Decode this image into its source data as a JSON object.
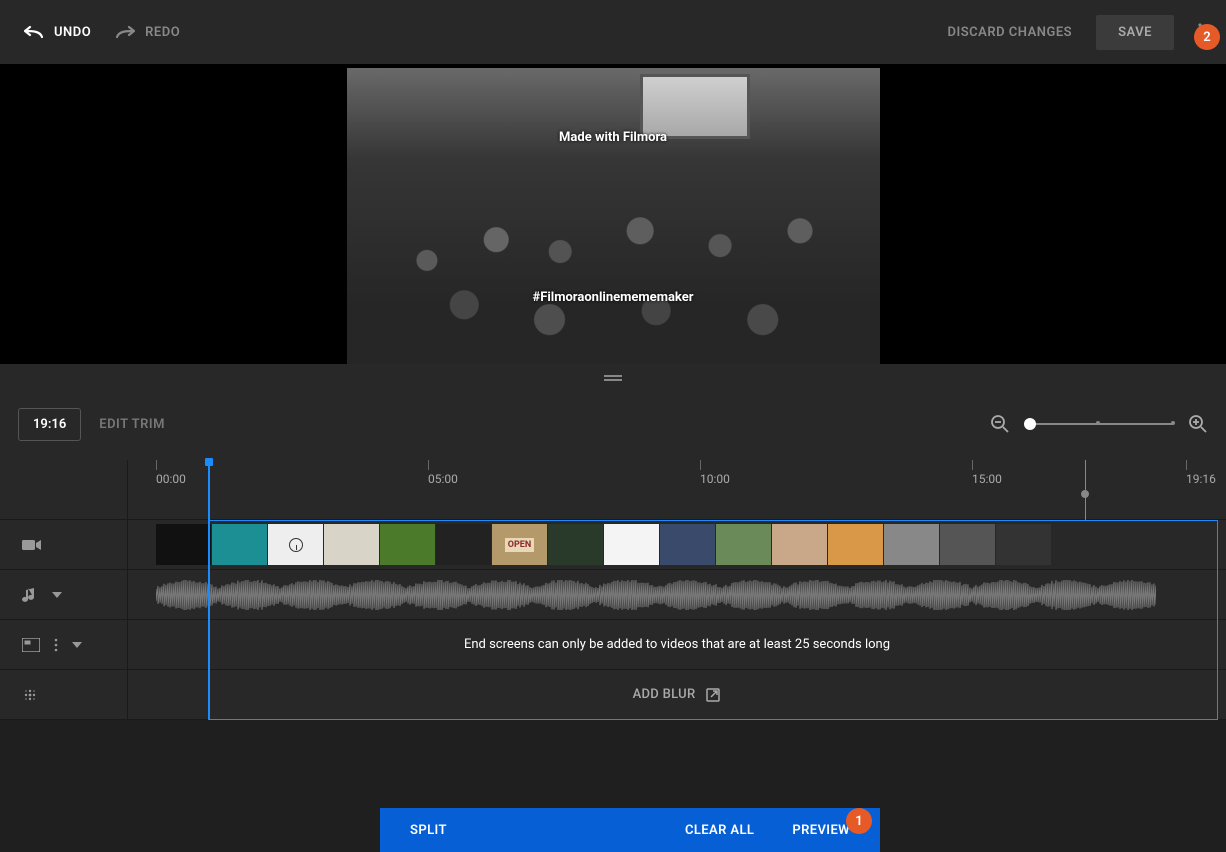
{
  "topbar": {
    "undo": "UNDO",
    "redo": "REDO",
    "discard": "DISCARD CHANGES",
    "save": "SAVE"
  },
  "badges": {
    "one": "1",
    "two": "2"
  },
  "preview": {
    "watermark_top": "Made with Filmora",
    "watermark_bottom": "#Filmoraonlinemememaker"
  },
  "controls": {
    "time": "19:16",
    "edit_trim": "EDIT TRIM"
  },
  "ruler": {
    "ticks": [
      "00:00",
      "05:00",
      "10:00",
      "15:00",
      "19:16"
    ]
  },
  "tracks": {
    "endscreen_msg": "End screens can only be added to videos that are at least 25 seconds long",
    "add_blur": "ADD BLUR"
  },
  "bottombar": {
    "split": "SPLIT",
    "clear_all": "CLEAR ALL",
    "preview": "PREVIEW"
  },
  "thumb_colors": [
    "#111",
    "#1b8f94",
    "#e8e8e8",
    "#d8d4c8",
    "#4a7a2a",
    "#222",
    "#b49a6a",
    "#2a3a2a",
    "#f4f4f4",
    "#3a4a6a",
    "#6a8a5a",
    "#c8a888",
    "#d89848",
    "#888",
    "#555",
    "#333"
  ]
}
